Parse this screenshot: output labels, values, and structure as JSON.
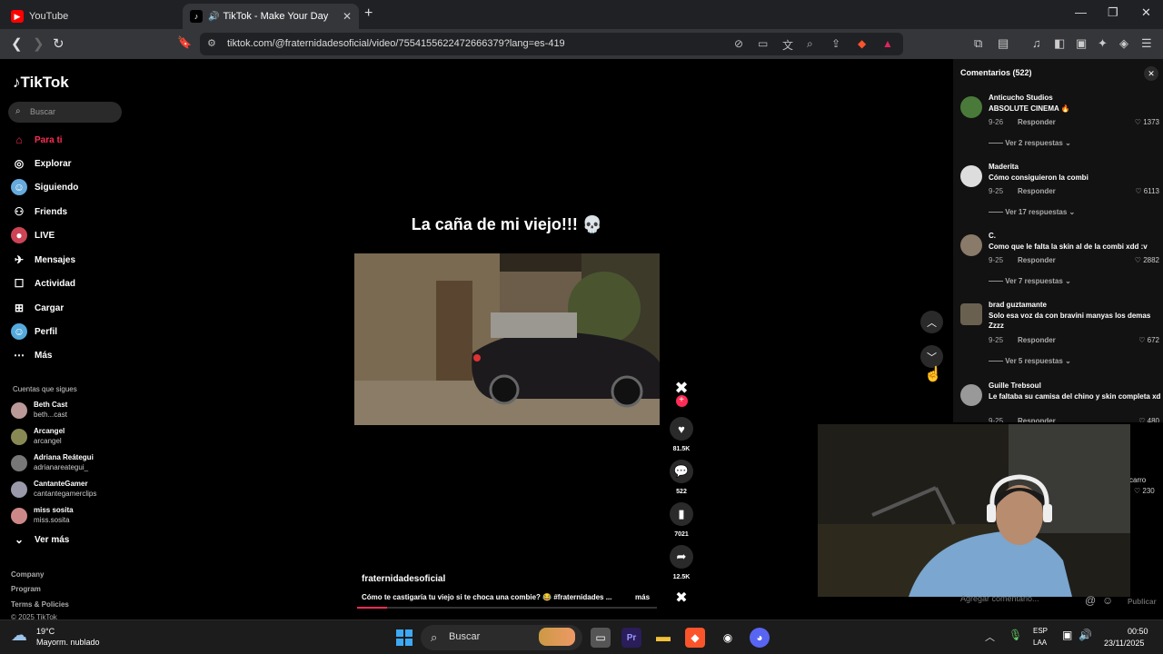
{
  "browser": {
    "tabs": [
      {
        "title": "YouTube",
        "active": false
      },
      {
        "title": "TikTok - Make Your Day",
        "active": true
      }
    ],
    "url": "tiktok.com/@fraternidadesoficial/video/7554155622472666379?lang=es-419"
  },
  "sidebar": {
    "logo": "TikTok",
    "search_placeholder": "Buscar",
    "nav": [
      {
        "label": "Para ti",
        "icon": "home-icon",
        "active": true
      },
      {
        "label": "Explorar",
        "icon": "compass-icon"
      },
      {
        "label": "Siguiendo",
        "icon": "following-icon"
      },
      {
        "label": "Friends",
        "icon": "friends-icon"
      },
      {
        "label": "LIVE",
        "icon": "live-icon"
      },
      {
        "label": "Mensajes",
        "icon": "messages-icon",
        "badge": "1"
      },
      {
        "label": "Actividad",
        "icon": "activity-icon",
        "badge": "1"
      },
      {
        "label": "Cargar",
        "icon": "upload-icon"
      },
      {
        "label": "Perfil",
        "icon": "profile-icon"
      },
      {
        "label": "Más",
        "icon": "more-icon"
      }
    ],
    "following_title": "Cuentas que sigues",
    "accounts": [
      {
        "name": "Beth Cast",
        "handle": "beth...cast"
      },
      {
        "name": "Arcangel",
        "handle": "arcangel"
      },
      {
        "name": "Adriana Reátegui",
        "handle": "adrianareategui_"
      },
      {
        "name": "CantanteGamer",
        "handle": "cantantegamerclips"
      },
      {
        "name": "miss sosita",
        "handle": "miss.sosita"
      }
    ],
    "see_more": "Ver más",
    "footer": [
      "Company",
      "Program",
      "Terms & Policies",
      "© 2025 TikTok"
    ]
  },
  "video": {
    "overlay_text": "La caña de mi viejo!!! 💀",
    "author": "fraternidadesoficial",
    "description": "Cómo te castigaría tu viejo si te choca una combie? 😂 #fraternidades ...",
    "more_label": "más",
    "progress_percent": 10,
    "actions": {
      "likes": "81.5K",
      "comments": "522",
      "saves": "7021",
      "shares": "12.5K"
    }
  },
  "comments_panel": {
    "title": "Comentarios (522)",
    "reply_label": "Responder",
    "items": [
      {
        "user": "Anticucho Studios",
        "text": "ABSOLUTE CINEMA 🔥",
        "date": "9-26",
        "likes": "1373",
        "replies": "Ver 2 respuestas"
      },
      {
        "user": "Maderita",
        "text": "Cómo consiguieron la combi",
        "date": "9-25",
        "likes": "6113",
        "replies": "Ver 17 respuestas"
      },
      {
        "user": "C.",
        "text": "Como que le falta la skin al de la combi xdd :v",
        "date": "9-25",
        "likes": "2882",
        "replies": "Ver 7 respuestas"
      },
      {
        "user": "brad guztamante",
        "text": "Solo esa voz da con bravini manyas los demas Zzzz",
        "date": "9-25",
        "likes": "672",
        "replies": "Ver 5 respuestas"
      },
      {
        "user": "Guille Trebsoul",
        "text": "Le faltaba su camisa del chino y skin completa xd",
        "date": "9-25",
        "likes": "480",
        "replies": ""
      }
    ],
    "partial_comment_text": "carro",
    "partial_comment_likes": "230",
    "input_placeholder": "Agregar comentario...",
    "publish_label": "Publicar"
  },
  "taskbar": {
    "weather_temp": "19°C",
    "weather_desc": "Mayorm. nublado",
    "search_label": "Buscar",
    "lang_line1": "ESP",
    "lang_line2": "LAA",
    "time": "00:50",
    "date": "23/11/2025"
  },
  "colors": {
    "accent": "#fe2c55",
    "panel_bg": "#121212",
    "browser_bg": "#35363a"
  }
}
